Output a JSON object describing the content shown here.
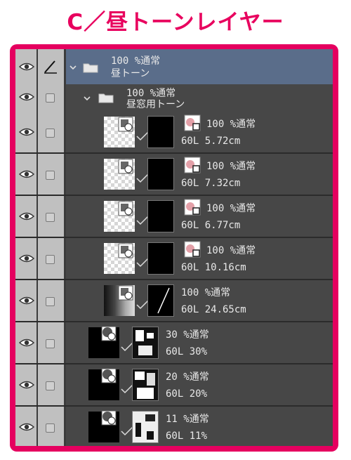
{
  "header": {
    "title": "C／昼トーンレイヤー"
  },
  "layers": [
    {
      "kind": "folder",
      "level": 0,
      "mode": "100 %通常",
      "name": "昼トーン",
      "selected": true
    },
    {
      "kind": "folder",
      "level": 1,
      "mode": "100 %通常",
      "name": "昼窓用トーン",
      "selected": false
    },
    {
      "kind": "tone",
      "mode": "100 %通常",
      "info": "60L 5.72cm"
    },
    {
      "kind": "tone",
      "mode": "100 %通常",
      "info": "60L 7.32cm"
    },
    {
      "kind": "tone",
      "mode": "100 %通常",
      "info": "60L 6.77cm"
    },
    {
      "kind": "tone",
      "mode": "100 %通常",
      "info": "60L 10.16cm"
    },
    {
      "kind": "tone",
      "mode": "100 %通常",
      "info": "60L 24.65cm"
    },
    {
      "kind": "tone2",
      "mode": "30 %通常",
      "info": "60L 30%"
    },
    {
      "kind": "tone2",
      "mode": "20 %通常",
      "info": "60L 20%"
    },
    {
      "kind": "tone2",
      "mode": "11 %通常",
      "info": "60L 11%"
    }
  ],
  "colors": {
    "accent": "#e5005f",
    "panel": "#474747",
    "selected": "#5a6d8a"
  }
}
